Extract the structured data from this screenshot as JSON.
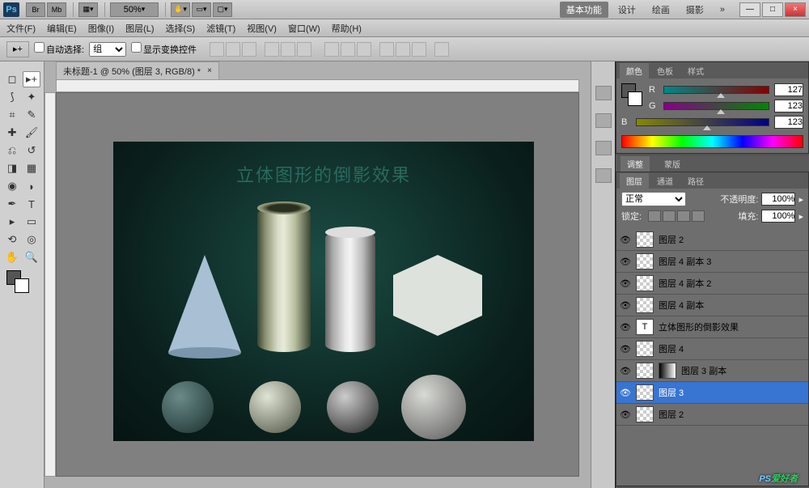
{
  "title_logo": "Ps",
  "zoom_level": "50%",
  "workspace_tabs": {
    "basic": "基本功能",
    "design": "设计",
    "paint": "绘画",
    "photo": "摄影"
  },
  "window_controls": {
    "min": "—",
    "max": "□",
    "close": "×"
  },
  "menu": {
    "file": "文件(F)",
    "edit": "编辑(E)",
    "image": "图像(I)",
    "layer": "图层(L)",
    "select": "选择(S)",
    "filter": "滤镜(T)",
    "view": "视图(V)",
    "window": "窗口(W)",
    "help": "帮助(H)"
  },
  "options": {
    "auto_select": "自动选择:",
    "group": "组",
    "show_transform": "显示变换控件"
  },
  "document_tab": "未标题-1 @ 50% (图层 3, RGB/8) *",
  "canvas_title": "立体图形的倒影效果",
  "color_panel": {
    "tab_color": "颜色",
    "tab_swatch": "色板",
    "tab_style": "样式",
    "r_label": "R",
    "g_label": "G",
    "b_label": "B",
    "r_val": "127",
    "g_val": "123",
    "b_val": "123"
  },
  "adjust_panel": {
    "adjust": "调整",
    "mask": "蒙版"
  },
  "layers_panel": {
    "tab_layers": "图层",
    "tab_channels": "通道",
    "tab_paths": "路径",
    "blend": "正常",
    "opacity_label": "不透明度:",
    "opacity": "100%",
    "lock_label": "锁定:",
    "fill_label": "填充:",
    "fill": "100%",
    "items": [
      {
        "name": "图层 2",
        "type": "normal"
      },
      {
        "name": "图层 4 副本 3",
        "type": "normal"
      },
      {
        "name": "图层 4 副本 2",
        "type": "normal"
      },
      {
        "name": "图层 4 副本",
        "type": "normal"
      },
      {
        "name": "立体图形的倒影效果",
        "type": "text"
      },
      {
        "name": "图层 4",
        "type": "normal"
      },
      {
        "name": "图层 3 副本",
        "type": "masked"
      },
      {
        "name": "图层 3",
        "type": "selected"
      },
      {
        "name": "图层 2",
        "type": "normal"
      }
    ]
  },
  "watermark": {
    "ps": "PS",
    "rest": "爱好者"
  },
  "eye_glyph": "👁",
  "doc_close": "×",
  "chevrons": "»"
}
